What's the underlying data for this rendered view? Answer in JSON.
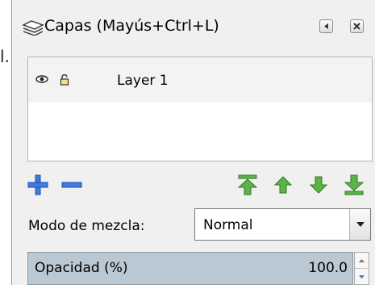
{
  "left_fragment": "l.",
  "panel": {
    "title": "Capas (Mayús+Ctrl+L)",
    "title_icon": "layers-icon",
    "title_buttons": [
      "dock-icon",
      "close-icon"
    ]
  },
  "layers": [
    {
      "name": "Layer 1",
      "visible_icon": "eye-icon",
      "lock_icon": "lock-open-icon"
    }
  ],
  "toolbar": {
    "buttons": [
      "add-layer-icon",
      "remove-layer-icon",
      "raise-to-top-icon",
      "raise-layer-icon",
      "lower-layer-icon",
      "lower-to-bottom-icon"
    ],
    "colors": {
      "add_remove": "#2e6ad9",
      "arrows": "#4ea83a"
    }
  },
  "blend": {
    "label": "Modo de mezcla:",
    "value": "Normal"
  },
  "opacity": {
    "label": "Opacidad (%)",
    "value": "100.0"
  }
}
